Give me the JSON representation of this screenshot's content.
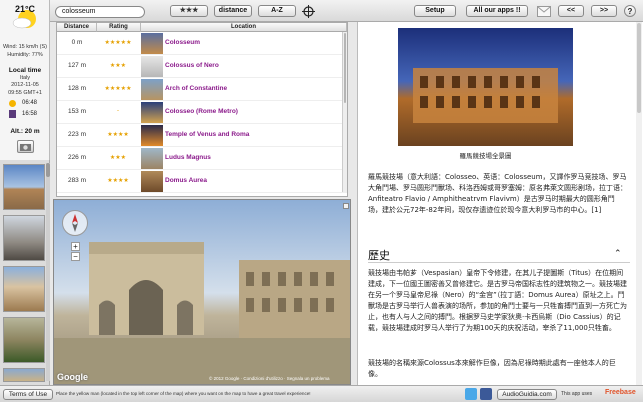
{
  "weather": {
    "temp": "21°C",
    "wind": "Wind: 15 km/h (S)",
    "humidity": "Humidity: 77%"
  },
  "local_time": {
    "label": "Local time",
    "country": "Italy",
    "date": "2012-11-05",
    "time": "09:55 GMT+1",
    "sunrise": "06:48",
    "sunset": "16:58"
  },
  "altitude": "Alt.: 20 m",
  "search": {
    "value": "colosseum"
  },
  "toolbar": {
    "stars": "★★★",
    "distance": "distance",
    "az": "A-Z",
    "setup": "Setup",
    "all_apps": "All our apps !!",
    "prev": "<<",
    "next": ">>",
    "help": "?"
  },
  "table": {
    "headers": [
      "Distance",
      "Rating",
      "Location"
    ],
    "rows": [
      {
        "dist": "0 m",
        "rating": "★★★★★",
        "name": "Colosseum"
      },
      {
        "dist": "127 m",
        "rating": "★★★",
        "name": "Colossus of Nero"
      },
      {
        "dist": "128 m",
        "rating": "★★★★★",
        "name": "Arch of Constantine"
      },
      {
        "dist": "153 m",
        "rating": "-",
        "name": "Colosseo (Rome Metro)"
      },
      {
        "dist": "223 m",
        "rating": "★★★★",
        "name": "Temple of Venus and Roma"
      },
      {
        "dist": "226 m",
        "rating": "★★★",
        "name": "Ludus Magnus"
      },
      {
        "dist": "283 m",
        "rating": "★★★★",
        "name": "Domus Aurea"
      }
    ]
  },
  "street": {
    "google": "Google",
    "copyright": "© 2012 Google · Condizioni d'utilizzo · Segnala un problema"
  },
  "right": {
    "caption": "羅馬競技場全景圖",
    "p1": "羅馬競技場（意大利語：Colosseo、英语：Colosseum，又譯作罗马竞技场、罗马大角鬥場、罗马圆形鬥獸场、科洛西姆或哥罗塞姆：原名弗萊文圆形剧场，拉丁语：Anfiteatro Flavio / Amphitheatrvm Flavivm）是古罗马时期最大的圆形角鬥场，建於公元72年-82年间，现仅存遗迹位於现今意大利罗马市的中心。[1]",
    "history_title": "歷史",
    "p2": "競技場由韦帕芗（Vespasian）皇帝下令修建，在其儿子提圖斯（Titus）在位期间建成，下一位國王圖密善又曾修建它。是古罗马帝国标志性的建筑物之一。競技場建在另一个罗马皇帝尼祿（Nero）的“金宫”（拉丁語：Domus Aurea）原址之上。鬥獸场是古罗马举行人兽表演的场所，参加的角鬥士要与一只牲畜搏鬥直到一方死亡为止，也有人与人之间的搏鬥。根据罗马史学家狄奧·卡西烏斯（Dio Cassius）的记载，競技場建成时罗马人举行了为期100天的庆祝活动，宰杀了11,000只牲畜。",
    "p3": "競技場的名稱來源Colossus本來解作巨像，因為尼祿時期此處有一座他本人的巨像。"
  },
  "bottom": {
    "terms": "Terms of Use",
    "hint": "Place the yellow man (located in the top left corner of the map) where you want on the map to have a great travel experience!",
    "audioguida": "AudioGuidia.com",
    "app_uses": "This app uses",
    "freebase": "Freebase"
  }
}
